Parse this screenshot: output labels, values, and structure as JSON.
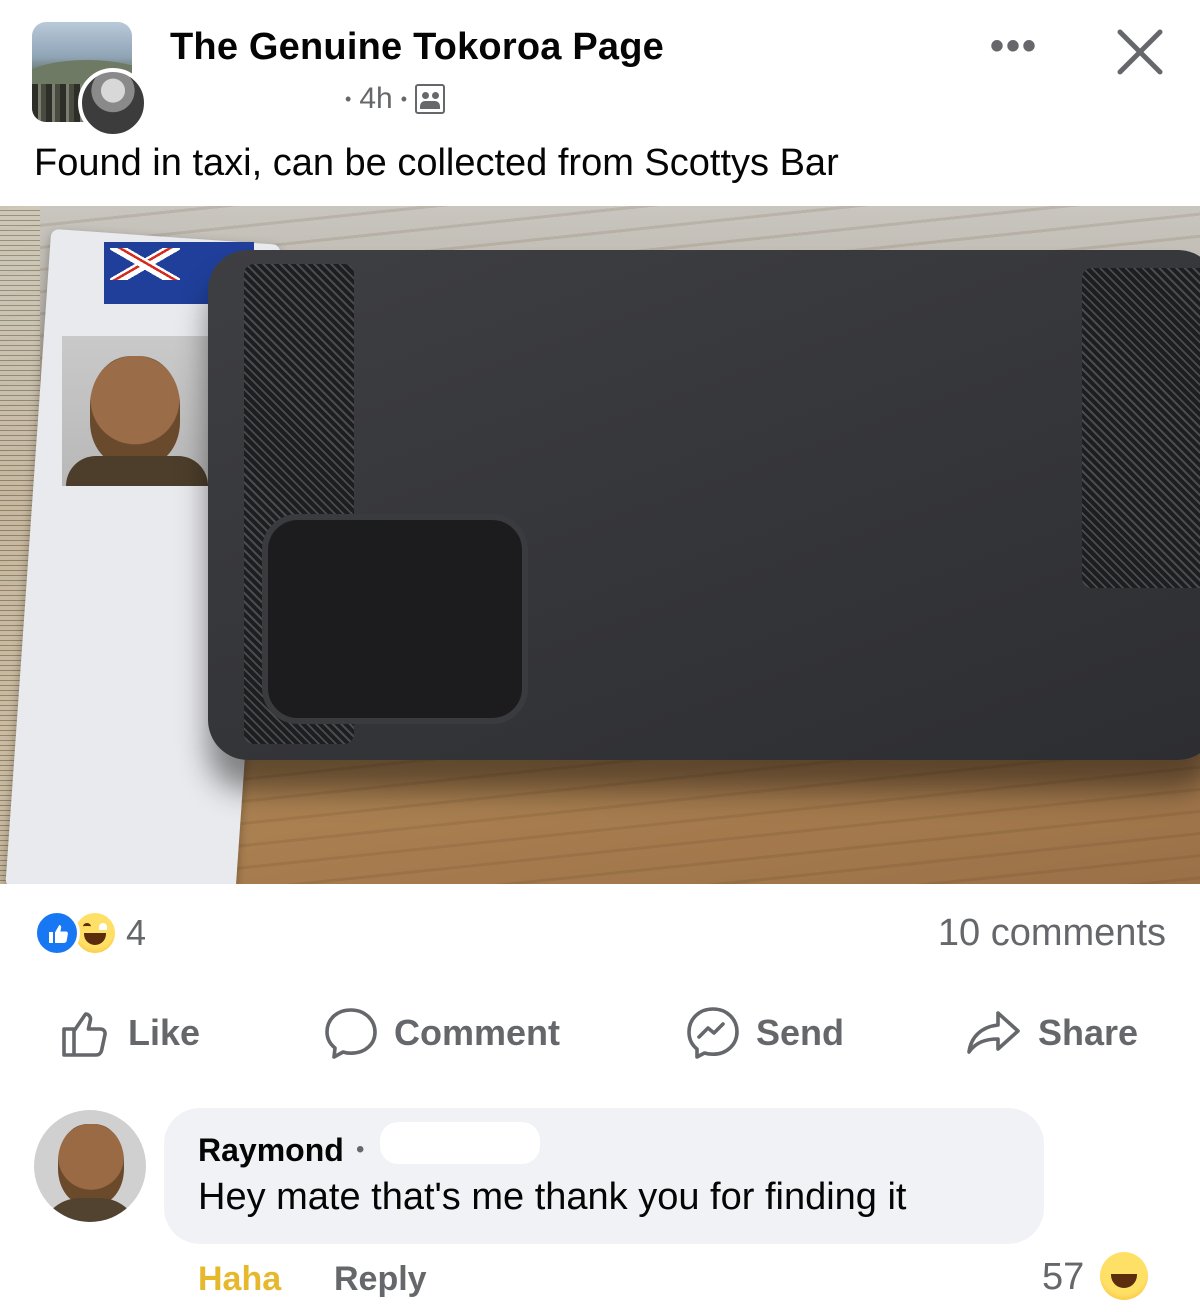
{
  "post": {
    "page_name": "The Genuine Tokoroa Page",
    "time": "4h",
    "text": "Found in taxi, can be collected from Scottys Bar",
    "audience_icon": "friends-icon"
  },
  "stats": {
    "reaction_count": "4",
    "comments": "10 comments"
  },
  "actions": {
    "like": "Like",
    "comment": "Comment",
    "send": "Send",
    "share": "Share"
  },
  "comment": {
    "author": "Raymond",
    "text": "Hey mate that's me thank you for finding it",
    "reaction_label": "Haha",
    "reply_label": "Reply",
    "reaction_count": "57"
  },
  "colors": {
    "accent": "#1877f2",
    "secondary_text": "#65676b",
    "haha": "#e6b82d"
  }
}
